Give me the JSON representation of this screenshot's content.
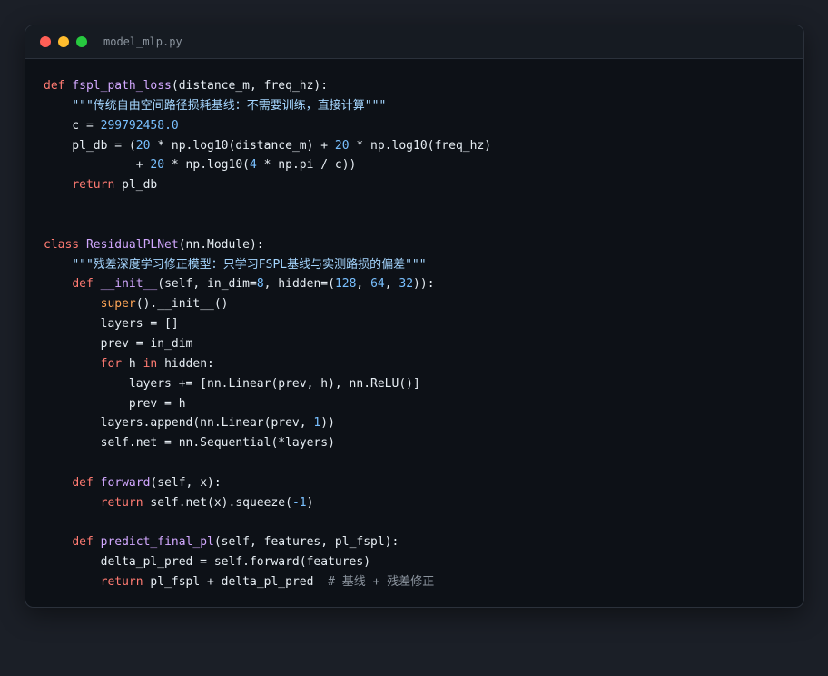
{
  "window": {
    "filename": "model_mlp.py",
    "controls": {
      "close_color": "#ff5f56",
      "minimize_color": "#ffbd2e",
      "maximize_color": "#27c93f"
    }
  },
  "theme": {
    "keyword": "#ff7b72",
    "function": "#d2a8ff",
    "number": "#79c0ff",
    "string": "#a5d6ff",
    "builtin": "#ffa657",
    "comment": "#8b949e",
    "text": "#e6edf3",
    "background": "#0d1117"
  },
  "code_lines": [
    [
      [
        "kw",
        "def "
      ],
      [
        "fn",
        "fspl_path_loss"
      ],
      [
        "plain",
        "(distance_m, freq_hz):"
      ]
    ],
    [
      [
        "plain",
        "    "
      ],
      [
        "str",
        "\"\"\"传统自由空间路径损耗基线：不需要训练，直接计算\"\"\""
      ]
    ],
    [
      [
        "plain",
        "    c = "
      ],
      [
        "num",
        "299792458.0"
      ]
    ],
    [
      [
        "plain",
        "    pl_db = ("
      ],
      [
        "num",
        "20"
      ],
      [
        "plain",
        " * np.log10(distance_m) + "
      ],
      [
        "num",
        "20"
      ],
      [
        "plain",
        " * np.log10(freq_hz)"
      ]
    ],
    [
      [
        "plain",
        "             + "
      ],
      [
        "num",
        "20"
      ],
      [
        "plain",
        " * np.log10("
      ],
      [
        "num",
        "4"
      ],
      [
        "plain",
        " * np.pi / c))"
      ]
    ],
    [
      [
        "plain",
        "    "
      ],
      [
        "kw",
        "return"
      ],
      [
        "plain",
        " pl_db"
      ]
    ],
    [],
    [],
    [
      [
        "kw",
        "class "
      ],
      [
        "cls",
        "ResidualPLNet"
      ],
      [
        "plain",
        "(nn.Module):"
      ]
    ],
    [
      [
        "plain",
        "    "
      ],
      [
        "str",
        "\"\"\"残差深度学习修正模型：只学习FSPL基线与实测路损的偏差\"\"\""
      ]
    ],
    [
      [
        "plain",
        "    "
      ],
      [
        "kw",
        "def "
      ],
      [
        "fn",
        "__init__"
      ],
      [
        "plain",
        "(self, in_dim="
      ],
      [
        "num",
        "8"
      ],
      [
        "plain",
        ", hidden=("
      ],
      [
        "num",
        "128"
      ],
      [
        "plain",
        ", "
      ],
      [
        "num",
        "64"
      ],
      [
        "plain",
        ", "
      ],
      [
        "num",
        "32"
      ],
      [
        "plain",
        "))"
      ],
      [
        "plain",
        ":"
      ]
    ],
    [
      [
        "plain",
        "        "
      ],
      [
        "builtin",
        "super"
      ],
      [
        "plain",
        "().__init__()"
      ]
    ],
    [
      [
        "plain",
        "        layers = []"
      ]
    ],
    [
      [
        "plain",
        "        prev = in_dim"
      ]
    ],
    [
      [
        "plain",
        "        "
      ],
      [
        "kw",
        "for"
      ],
      [
        "plain",
        " h "
      ],
      [
        "kw",
        "in"
      ],
      [
        "plain",
        " hidden:"
      ]
    ],
    [
      [
        "plain",
        "            layers += [nn.Linear(prev, h), nn.ReLU()]"
      ]
    ],
    [
      [
        "plain",
        "            prev = h"
      ]
    ],
    [
      [
        "plain",
        "        layers.append(nn.Linear(prev, "
      ],
      [
        "num",
        "1"
      ],
      [
        "plain",
        "))"
      ]
    ],
    [
      [
        "plain",
        "        self.net = nn.Sequential(*layers)"
      ]
    ],
    [],
    [
      [
        "plain",
        "    "
      ],
      [
        "kw",
        "def "
      ],
      [
        "fn",
        "forward"
      ],
      [
        "plain",
        "(self, x):"
      ]
    ],
    [
      [
        "plain",
        "        "
      ],
      [
        "kw",
        "return"
      ],
      [
        "plain",
        " self.net(x).squeeze("
      ],
      [
        "num",
        "-1"
      ],
      [
        "plain",
        ")"
      ]
    ],
    [],
    [
      [
        "plain",
        "    "
      ],
      [
        "kw",
        "def "
      ],
      [
        "fn",
        "predict_final_pl"
      ],
      [
        "plain",
        "(self, features, pl_fspl):"
      ]
    ],
    [
      [
        "plain",
        "        delta_pl_pred = self.forward(features)"
      ]
    ],
    [
      [
        "plain",
        "        "
      ],
      [
        "kw",
        "return"
      ],
      [
        "plain",
        " pl_fspl + delta_pl_pred  "
      ],
      [
        "cm",
        "# 基线 + 残差修正"
      ]
    ]
  ]
}
